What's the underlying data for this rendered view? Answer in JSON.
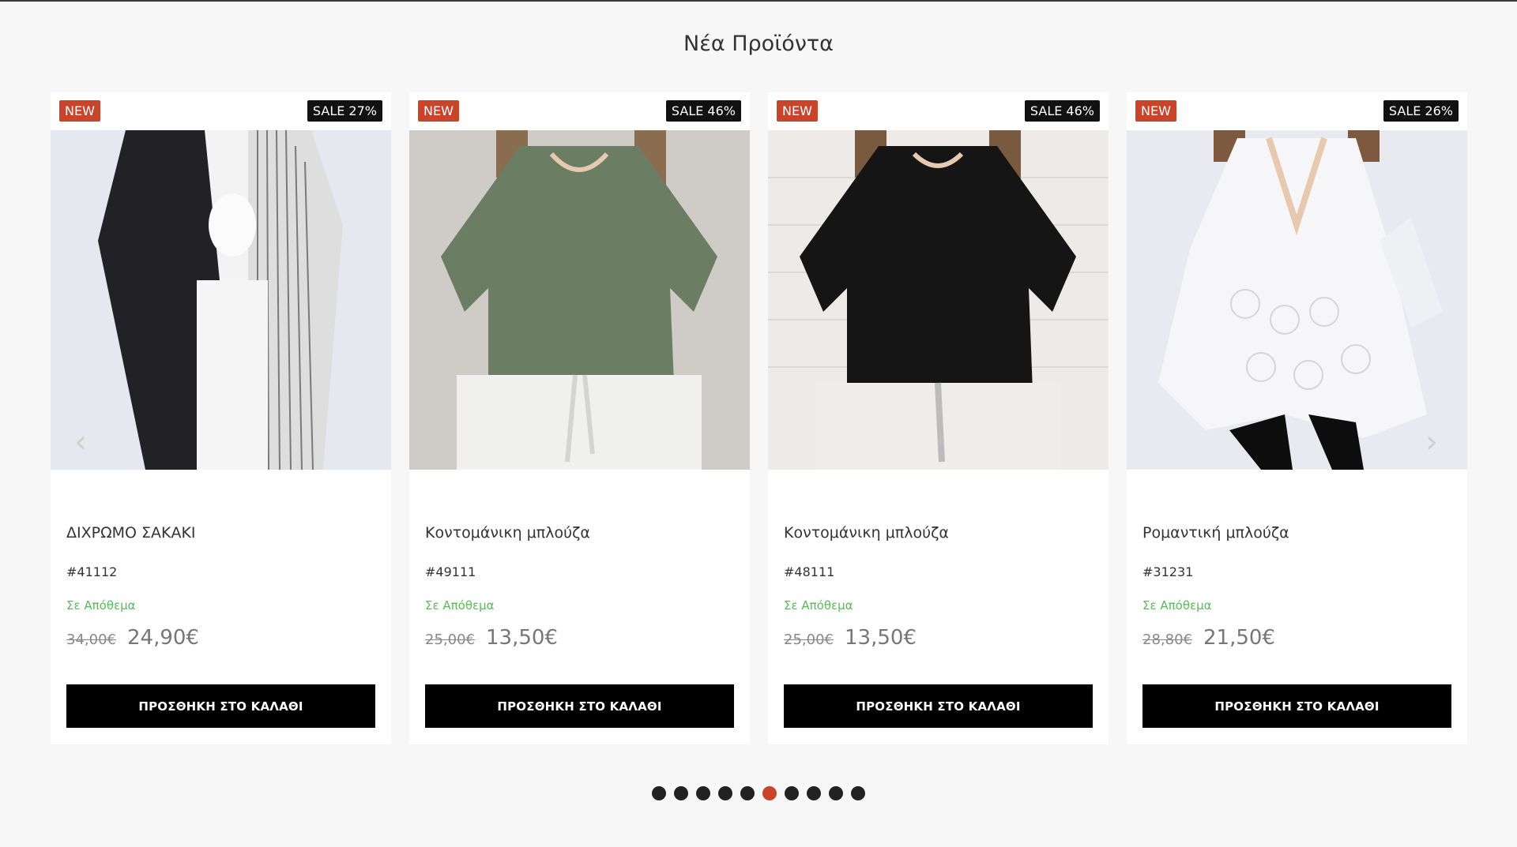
{
  "section": {
    "title": "Νέα Προϊόντα"
  },
  "products": [
    {
      "badge_new": "NEW",
      "badge_sale": "SALE 27%",
      "name": "ΔΙΧΡΩΜΟ ΣΑΚΑΚΙ",
      "sku": "#41112",
      "stock": "Σε Απόθεμα",
      "old_price": "34,00€",
      "price": "24,90€",
      "button": "ΠΡΟΣΘΗΚΗ ΣΤΟ ΚΑΛΑΘΙ"
    },
    {
      "badge_new": "NEW",
      "badge_sale": "SALE 46%",
      "name": "Κοντομάνικη μπλούζα",
      "sku": "#49111",
      "stock": "Σε Απόθεμα",
      "old_price": "25,00€",
      "price": "13,50€",
      "button": "ΠΡΟΣΘΗΚΗ ΣΤΟ ΚΑΛΑΘΙ"
    },
    {
      "badge_new": "NEW",
      "badge_sale": "SALE 46%",
      "name": "Κοντομάνικη μπλούζα",
      "sku": "#48111",
      "stock": "Σε Απόθεμα",
      "old_price": "25,00€",
      "price": "13,50€",
      "button": "ΠΡΟΣΘΗΚΗ ΣΤΟ ΚΑΛΑΘΙ"
    },
    {
      "badge_new": "NEW",
      "badge_sale": "SALE 26%",
      "name": "Ρομαντική μπλούζα",
      "sku": "#31231",
      "stock": "Σε Απόθεμα",
      "old_price": "28,80€",
      "price": "21,50€",
      "button": "ΠΡΟΣΘΗΚΗ ΣΤΟ ΚΑΛΑΘΙ"
    }
  ],
  "carousel": {
    "prev_icon": "chevron-left-icon",
    "next_icon": "chevron-right-icon",
    "prev_glyph": "‹",
    "next_glyph": "›",
    "dot_count": 10,
    "active_dot": 6
  },
  "colors": {
    "accent": "#c8442a",
    "in_stock": "#5cb85c",
    "button_bg": "#000000",
    "page_bg": "#f7f7f7"
  }
}
